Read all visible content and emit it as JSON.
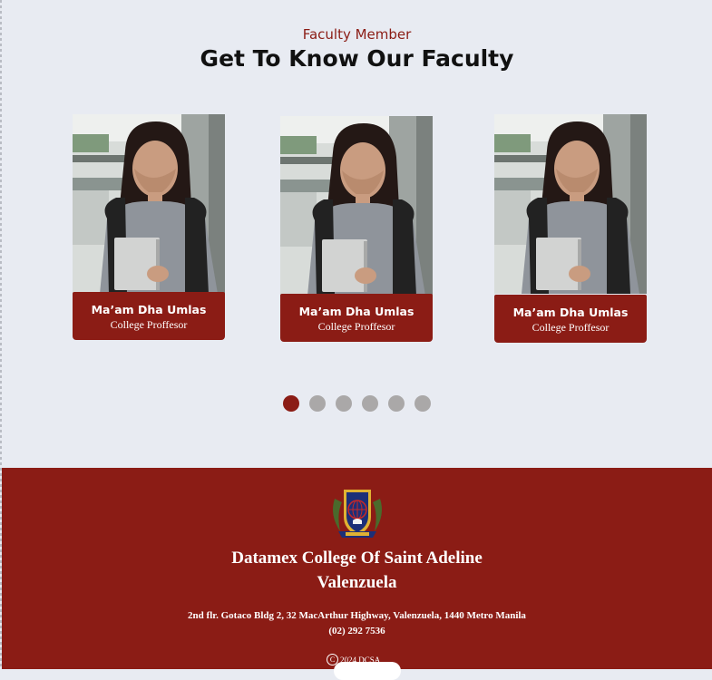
{
  "section": {
    "eyebrow": "Faculty Member",
    "heading": "Get To Know Our Faculty"
  },
  "faculty": [
    {
      "name": "Ma’am Dha Umlas",
      "role": "College Proffesor"
    },
    {
      "name": "Ma’am Dha Umlas",
      "role": "College Proffesor"
    },
    {
      "name": "Ma’am Dha Umlas",
      "role": "College Proffesor"
    }
  ],
  "carousel": {
    "pages": 6,
    "active_index": 0
  },
  "footer": {
    "school_line1": "Datamex College Of Saint Adeline",
    "school_line2": "Valenzuela",
    "address": "2nd flr. Gotaco Bldg 2, 32 MacArthur Highway, Valenzuela, 1440 Metro Manila",
    "phone": "(02) 292 7536",
    "copyright_symbol": "C",
    "copyright": "2024 DCSA"
  },
  "colors": {
    "accent": "#8b1c15",
    "background": "#e8ebf2",
    "dot_inactive": "#aaa8a8"
  },
  "icons": [
    "school-crest-icon",
    "copyright-icon"
  ]
}
